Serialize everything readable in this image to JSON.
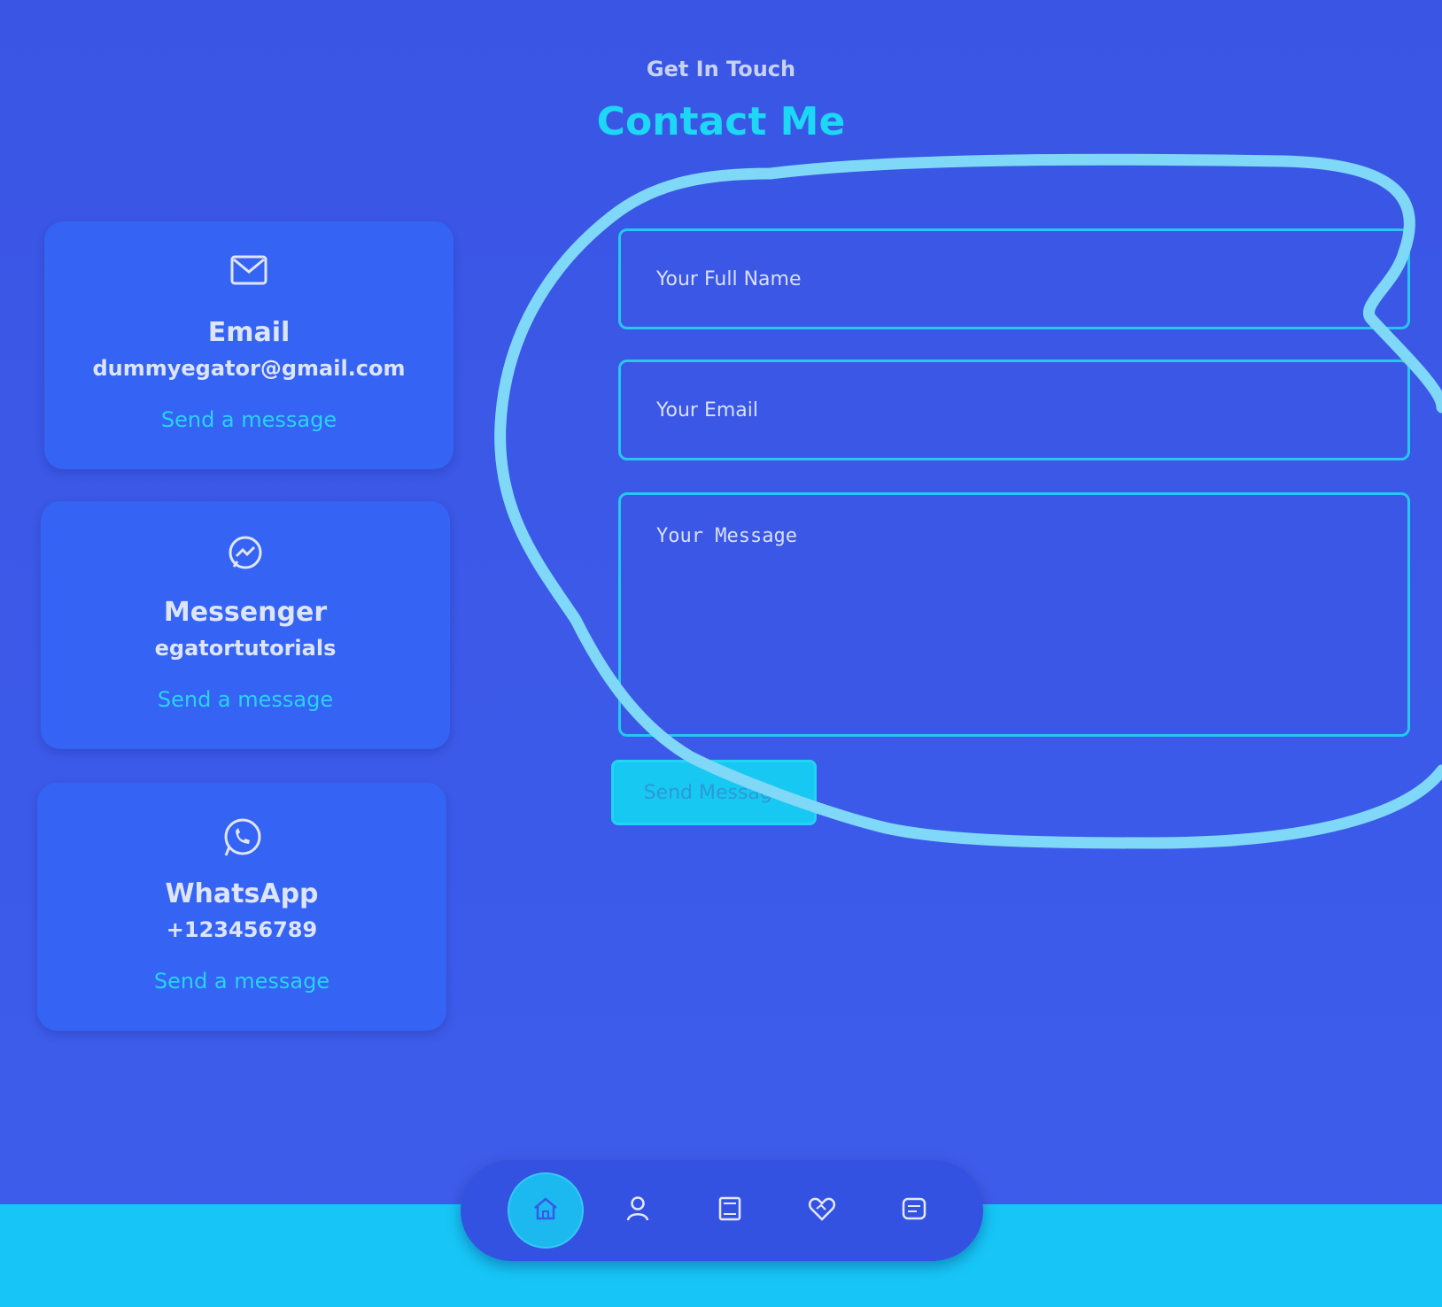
{
  "header": {
    "subtitle": "Get In Touch",
    "title": "Contact Me"
  },
  "cards": [
    {
      "icon": "envelope-icon",
      "title": "Email",
      "value": "dummyegator@gmail.com",
      "link": "Send a message"
    },
    {
      "icon": "messenger-icon",
      "title": "Messenger",
      "value": "egatortutorials",
      "link": "Send a message"
    },
    {
      "icon": "whatsapp-icon",
      "title": "WhatsApp",
      "value": "+123456789",
      "link": "Send a message"
    }
  ],
  "form": {
    "name_placeholder": "Your Full Name",
    "email_placeholder": "Your Email",
    "message_placeholder": "Your Message",
    "send_label": "Send Message"
  },
  "nav": {
    "items": [
      "home-icon",
      "user-icon",
      "book-icon",
      "heart-handshake-icon",
      "message-square-icon"
    ],
    "active_index": 0
  },
  "colors": {
    "background": "#3b56e6",
    "accent": "#1cd7f5",
    "card": "#3563f3",
    "scribble": "#7fd8f7"
  }
}
